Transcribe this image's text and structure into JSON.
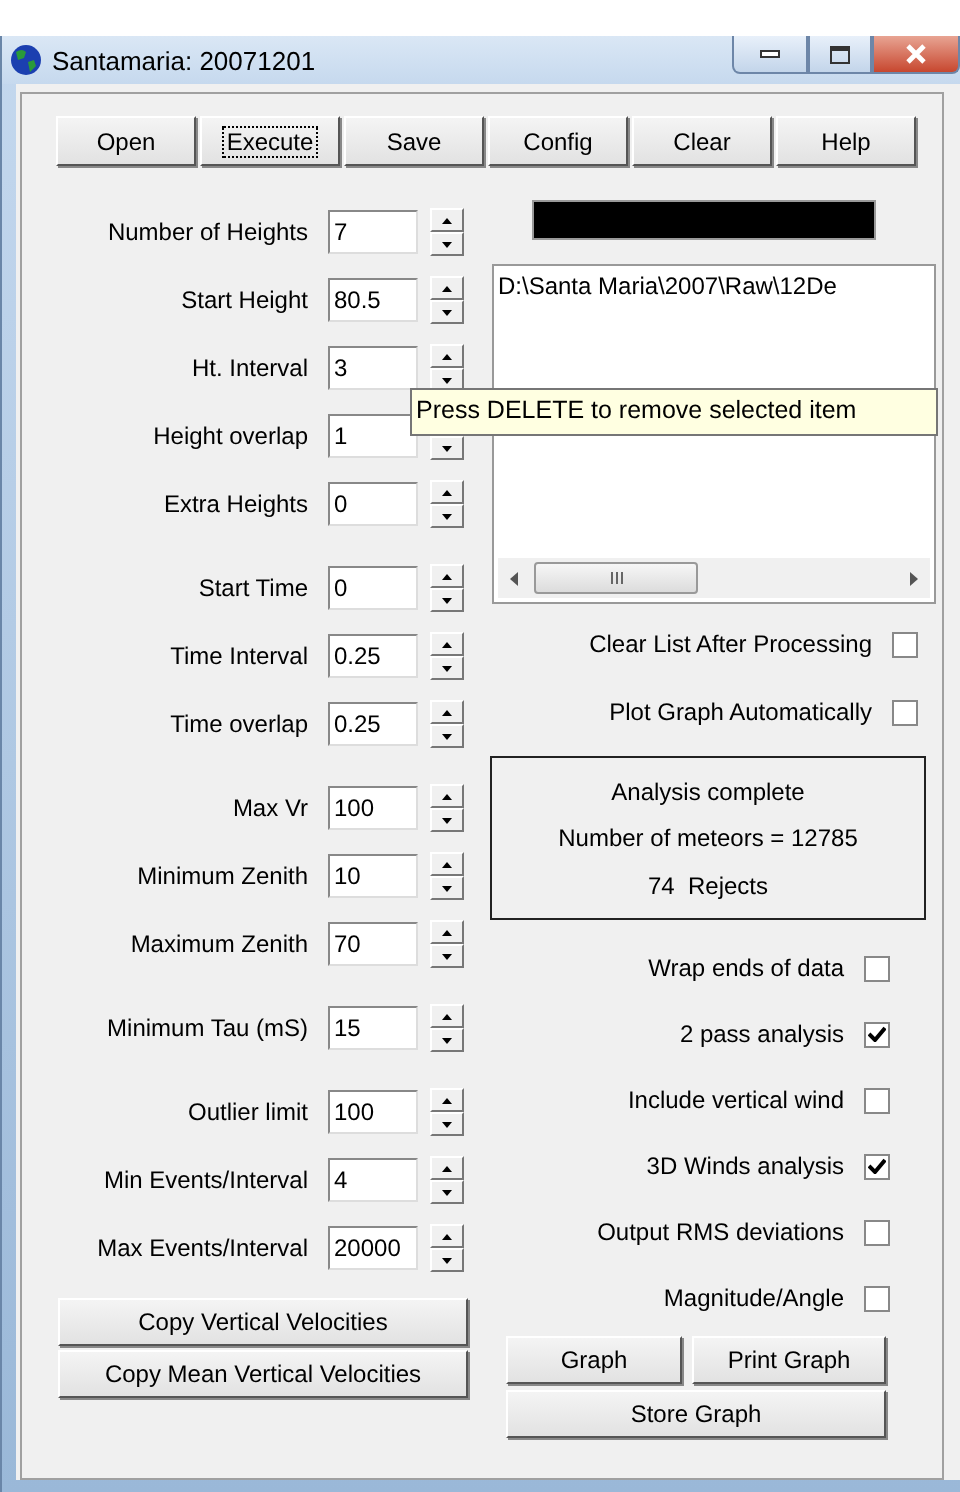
{
  "window": {
    "title": "Santamaria: 20071201"
  },
  "toolbar": [
    {
      "label": "Open",
      "focused": false
    },
    {
      "label": "Execute",
      "focused": true
    },
    {
      "label": "Save",
      "focused": false
    },
    {
      "label": "Config",
      "focused": false
    },
    {
      "label": "Clear",
      "focused": false
    },
    {
      "label": "Help",
      "focused": false
    }
  ],
  "parameter_groups": [
    [
      {
        "label": "Number of Heights",
        "value": "7"
      },
      {
        "label": "Start Height",
        "value": "80.5"
      },
      {
        "label": "Ht. Interval",
        "value": "3"
      },
      {
        "label": "Height overlap",
        "value": "1"
      },
      {
        "label": "Extra Heights",
        "value": "0"
      }
    ],
    [
      {
        "label": "Start Time",
        "value": "0"
      },
      {
        "label": "Time Interval",
        "value": "0.25"
      },
      {
        "label": "Time overlap",
        "value": "0.25"
      }
    ],
    [
      {
        "label": "Max Vr",
        "value": "100"
      },
      {
        "label": "Minimum Zenith",
        "value": "10"
      },
      {
        "label": "Maximum Zenith",
        "value": "70"
      }
    ],
    [
      {
        "label": "Minimum Tau (mS)",
        "value": "15"
      }
    ],
    [
      {
        "label": "Outlier limit",
        "value": "100"
      },
      {
        "label": "Min Events/Interval",
        "value": "4"
      },
      {
        "label": "Max Events/Interval",
        "value": "20000"
      }
    ]
  ],
  "copy_buttons": [
    "Copy Vertical Velocities",
    "Copy Mean Vertical Velocities"
  ],
  "file_list": {
    "items": [
      "D:\\Santa Maria\\2007\\Raw\\12De"
    ]
  },
  "tooltip": "Press DELETE to remove selected item",
  "list_options": [
    {
      "label": "Clear List After Processing",
      "checked": false
    },
    {
      "label": "Plot Graph Automatically",
      "checked": false
    }
  ],
  "result": {
    "lines": [
      "Analysis complete",
      "Number of meteors = 12785",
      "74  Rejects"
    ]
  },
  "analysis_options": [
    {
      "label": "Wrap ends of data",
      "checked": false
    },
    {
      "label": "2 pass analysis",
      "checked": true
    },
    {
      "label": "Include vertical wind",
      "checked": false
    },
    {
      "label": "3D Winds analysis",
      "checked": true
    },
    {
      "label": "Output RMS deviations",
      "checked": false
    },
    {
      "label": "Magnitude/Angle",
      "checked": false
    }
  ],
  "graph_buttons": [
    "Graph",
    "Print Graph"
  ],
  "store_button": "Store Graph"
}
